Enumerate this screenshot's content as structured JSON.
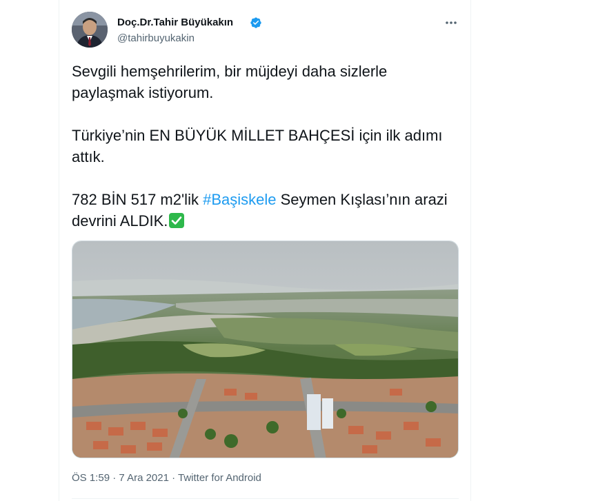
{
  "author": {
    "name": "Doç.Dr.Tahir Büyükakın",
    "handle": "@tahirbuyukakin",
    "verified": true
  },
  "icons": {
    "verified": "verified-badge-icon",
    "more": "more-horizontal-icon",
    "check": "check-mark-button-emoji"
  },
  "tweet": {
    "paragraph1": "Sevgili hemşehrilerim, bir müjdeyi daha sizlerle paylaşmak istiyorum.",
    "paragraph2": "Türkiye’nin EN BÜYÜK MİLLET BAHÇESİ için ilk adımı attık.",
    "paragraph3_before": "782 BİN 517 m2'lik ",
    "hashtag": "#Başiskele",
    "paragraph3_after": " Seymen Kışlası’nın arazi devrini ALDIK.",
    "photo_alt": "aerial-photo-seymen-kislasi"
  },
  "meta": {
    "time": "ÖS 1:59",
    "separator1": " · ",
    "date": "7 Ara 2021",
    "separator2": " · ",
    "source": "Twitter for Android"
  },
  "colors": {
    "link": "#1d9bf0",
    "verified": "#1d9bf0",
    "text": "#0f1419",
    "secondary": "#536471",
    "check_emoji": "#2eb84b"
  }
}
